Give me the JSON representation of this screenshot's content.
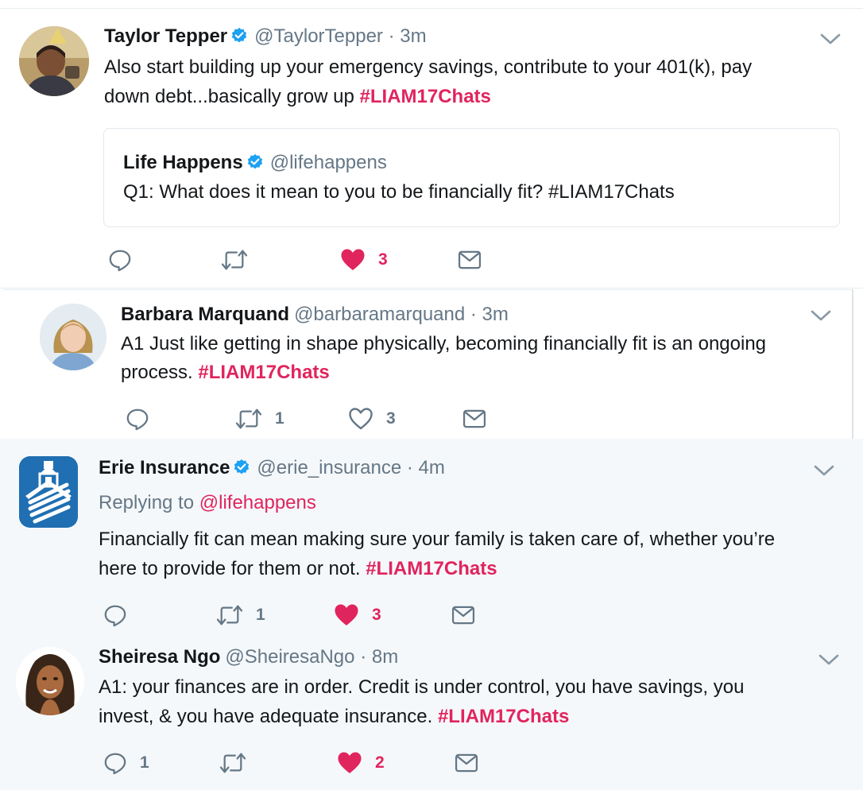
{
  "colors": {
    "hashtag": "#e0245e",
    "secondary_text": "#657786",
    "liked": "#e0245e",
    "verified": "#1da1f2"
  },
  "tweets": [
    {
      "name": "Taylor Tepper",
      "verified": true,
      "handle": "@TaylorTepper",
      "time": "· 3m",
      "text_line1": "Also start building up your emergency savings, contribute to your 401(k), pay",
      "text_line2": "down debt...basically grow up ",
      "hashtag": "#LIAM17Chats",
      "quote": {
        "name": "Life Happens",
        "verified": true,
        "handle": "@lifehappens",
        "text": "Q1: What does it mean to you to be financially fit? #LIAM17Chats"
      },
      "reply_count": "",
      "retweet_count": "",
      "like_count": "3",
      "liked": true
    },
    {
      "name": "Barbara Marquand",
      "verified": false,
      "handle": "@barbaramarquand",
      "time": "· 3m",
      "text_line1": "A1 Just like getting in shape physically, becoming financially fit is an ongoing",
      "text_line2": "process. ",
      "hashtag": "#LIAM17Chats",
      "reply_count": "",
      "retweet_count": "1",
      "like_count": "3",
      "liked": false
    },
    {
      "name": "Erie Insurance",
      "verified": true,
      "handle": "@erie_insurance",
      "time": "· 4m",
      "replying_to_label": "Replying to ",
      "replying_to_handle": "@lifehappens",
      "text_line1": "Financially fit can mean making sure your family is taken care of, whether you’re",
      "text_line2": "here to provide for them or not. ",
      "hashtag": "#LIAM17Chats",
      "reply_count": "",
      "retweet_count": "1",
      "like_count": "3",
      "liked": true
    },
    {
      "name": "Sheiresa Ngo",
      "verified": false,
      "handle": "@SheiresaNgo",
      "time": "· 8m",
      "text_line1": "A1: your finances are in order. Credit is under control, you have savings, you",
      "text_line2": "invest, & you have adequate insurance. ",
      "hashtag": "#LIAM17Chats",
      "reply_count": "1",
      "retweet_count": "",
      "like_count": "2",
      "liked": true
    }
  ],
  "icons": {
    "reply": "reply-icon",
    "retweet": "retweet-icon",
    "like": "heart-icon",
    "dm": "envelope-icon",
    "more": "chevron-down-icon",
    "verified": "verified-badge-icon"
  }
}
